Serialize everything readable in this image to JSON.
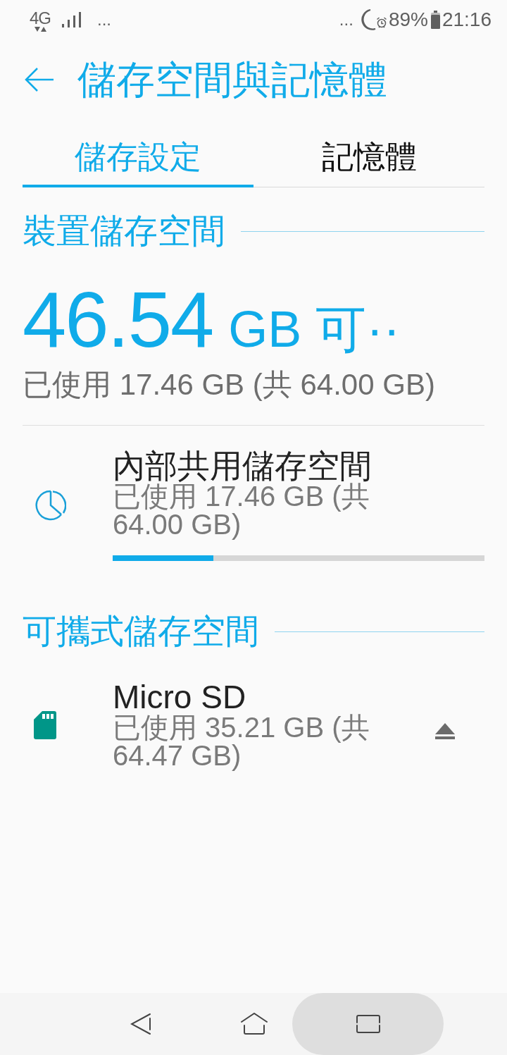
{
  "status_bar": {
    "network": "4G",
    "left_more": "...",
    "right_more": "...",
    "battery": "89%",
    "time": "21:16"
  },
  "header": {
    "title": "儲存空間與記憶體"
  },
  "tabs": [
    {
      "label": "儲存設定",
      "selected": true
    },
    {
      "label": "記憶體",
      "selected": false
    }
  ],
  "device_storage": {
    "heading": "裝置儲存空間",
    "free_amount": "46.54",
    "free_unit": "GB 可··",
    "usage": "已使用 17.46 GB (共 64.00 GB)",
    "volumes": [
      {
        "kind": "internal",
        "title": "內部共用儲存空間",
        "usage": "已使用 17.46 GB (共 64.00 GB)",
        "level": 0.27,
        "ejectable": false
      }
    ]
  },
  "portable_storage": {
    "heading": "可攜式儲存空間",
    "volumes": [
      {
        "kind": "sdcard",
        "title": "Micro SD",
        "usage": "已使用 35.21 GB (共 64.47 GB)",
        "ejectable": true
      }
    ]
  },
  "nav_bar": [
    {
      "kind": "back",
      "pressed": false
    },
    {
      "kind": "home",
      "pressed": false
    },
    {
      "kind": "recents",
      "pressed": true
    }
  ]
}
